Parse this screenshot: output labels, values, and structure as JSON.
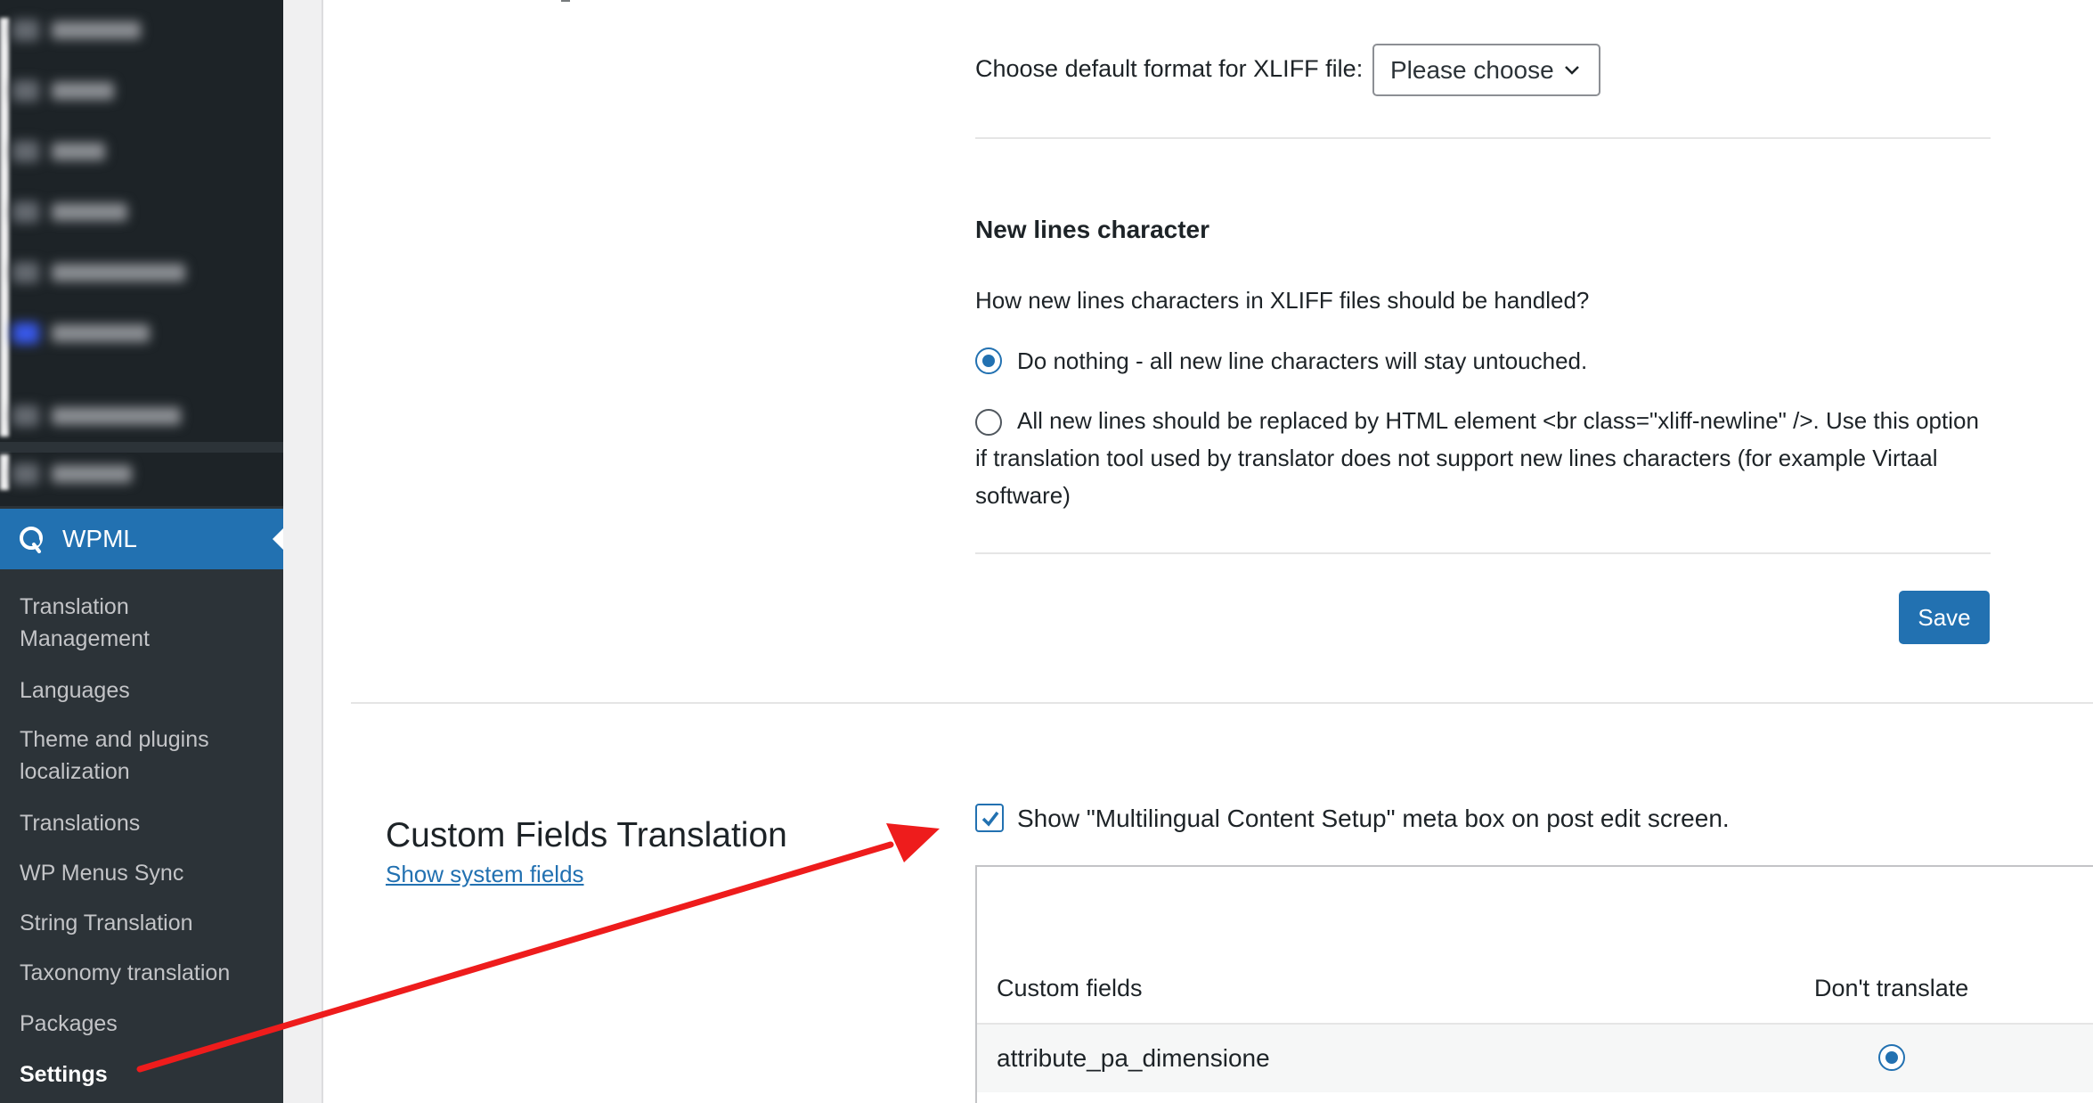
{
  "sidebar": {
    "active_menu": "WPML",
    "submenu": [
      {
        "label": "Translation\nManagement"
      },
      {
        "label": "Languages"
      },
      {
        "label": "Theme and plugins\nlocalization"
      },
      {
        "label": "Translations"
      },
      {
        "label": "WP Menus Sync"
      },
      {
        "label": "String Translation"
      },
      {
        "label": "Taxonomy translation"
      },
      {
        "label": "Packages"
      },
      {
        "label": "Settings"
      }
    ]
  },
  "xliff": {
    "format_label": "Choose default format for XLIFF file:",
    "format_selected": "Please choose"
  },
  "new_lines": {
    "title": "New lines character",
    "question": "How new lines characters in XLIFF files should be handled?",
    "option_nothing": "Do nothing - all new line characters will stay untouched.",
    "option_replace": "All new lines should be replaced by HTML element <br class=\"xliff-newline\" />. Use this option if translation tool used by translator does not support new lines characters (for example Virtaal software)",
    "selected": "nothing"
  },
  "save_label": "Save",
  "custom_fields": {
    "title": "Custom Fields Translation",
    "show_system_link": "Show system fields",
    "meta_box_label": "Show \"Multilingual Content Setup\" meta box on post edit screen.",
    "meta_box_checked": true,
    "table": {
      "col_name": "Custom fields",
      "col_dont_translate": "Don't translate",
      "rows": [
        {
          "name": "attribute_pa_dimensione",
          "selected": "dont_translate"
        }
      ]
    }
  },
  "annotation_color": "#ee1c1c"
}
